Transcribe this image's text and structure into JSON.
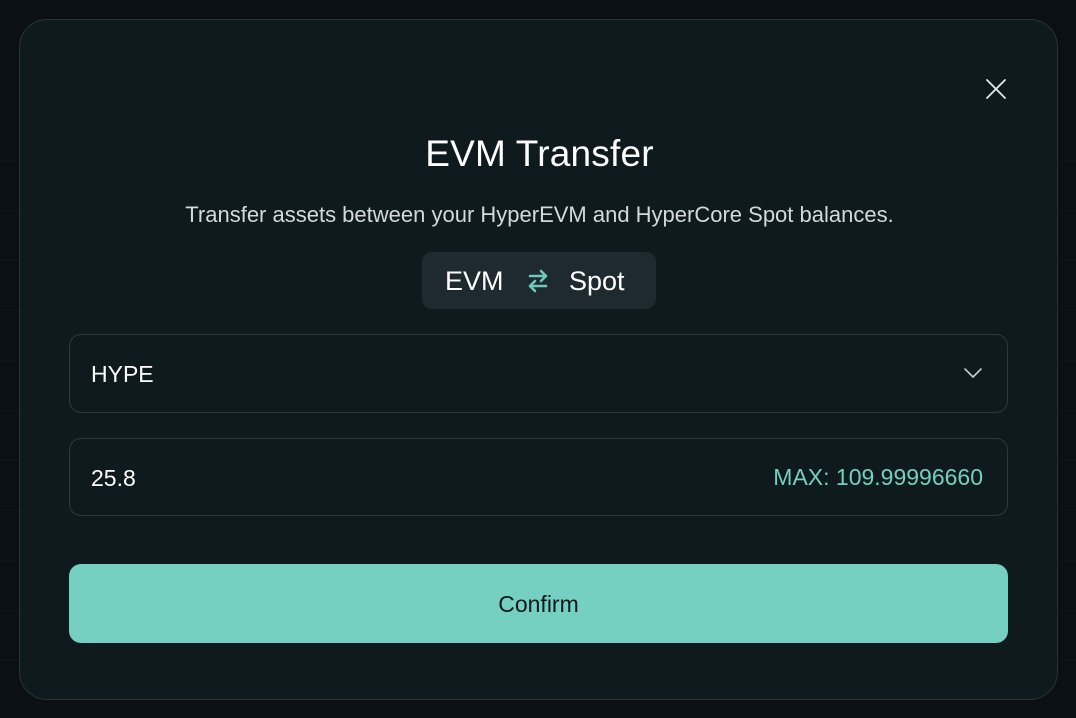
{
  "modal": {
    "title": "EVM Transfer",
    "subtitle": "Transfer assets between your HyperEVM and HyperCore Spot balances.",
    "close_icon": "close-icon",
    "direction": {
      "from": "EVM",
      "to": "Spot",
      "swap_icon": "swap-arrows-icon"
    },
    "asset_select": {
      "selected": "HYPE",
      "chevron_icon": "chevron-down-icon"
    },
    "amount": {
      "value": "25.8",
      "max_label": "MAX: 109.99996660"
    },
    "confirm_label": "Confirm"
  },
  "colors": {
    "modal_background": "#0f1a1f",
    "accent": "#76d0c1",
    "max_text": "#74cfbf",
    "border": "#2e393e",
    "toggle_background": "#1f2a30"
  }
}
